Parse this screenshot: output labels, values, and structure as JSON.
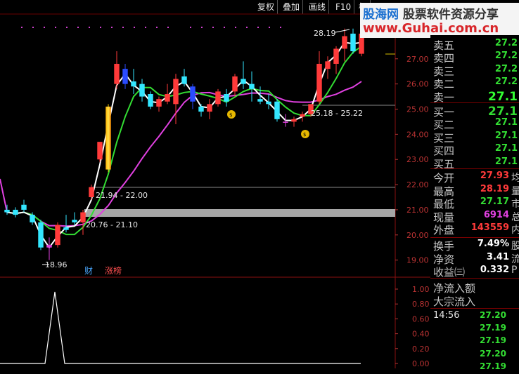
{
  "toolbar": {
    "items": [
      "复权",
      "叠加",
      "画线",
      "F10",
      "标"
    ]
  },
  "watermark": {
    "brand_a": "股海网",
    "brand_b": "股票软件资源分享",
    "url": "www.Guhai.com.cn"
  },
  "chart": {
    "price_axis": [
      "27.00",
      "26.00",
      "25.00",
      "24.00",
      "23.00",
      "22.00",
      "21.00",
      "20.00",
      "19.00"
    ],
    "indicator_axis": [
      "1.00",
      "0.80",
      "0.60",
      "0.40",
      "0.20",
      "0.00"
    ],
    "labels": {
      "high": "28.19",
      "low": "18.96",
      "range1": "21.94 - 22.00",
      "range2": "20.76 - 21.10",
      "range3": "25.18 - 25.22"
    },
    "tags": {
      "cai": "财",
      "zhangbang": "涨榜"
    },
    "colors": {
      "up": "#ff3a3a",
      "down": "#33e6ff",
      "ma_white": "#ffffff",
      "ma_green": "#33dd33",
      "ma_magenta": "#e040e0",
      "axis_red": "#b33333"
    },
    "chart_data": {
      "type": "candlestick",
      "series": [
        {
          "o": 21.0,
          "h": 21.2,
          "l": 20.8,
          "c": 20.9
        },
        {
          "o": 21.0,
          "h": 21.1,
          "l": 20.7,
          "c": 20.8
        },
        {
          "o": 21.2,
          "h": 21.4,
          "l": 20.9,
          "c": 21.0
        },
        {
          "o": 20.8,
          "h": 20.9,
          "l": 20.4,
          "c": 20.5
        },
        {
          "o": 20.5,
          "h": 20.6,
          "l": 19.4,
          "c": 19.5
        },
        {
          "o": 19.6,
          "h": 19.9,
          "l": 19.0,
          "c": 19.5
        },
        {
          "o": 19.6,
          "h": 20.5,
          "l": 19.5,
          "c": 20.4
        },
        {
          "o": 20.3,
          "h": 20.8,
          "l": 20.1,
          "c": 20.2
        },
        {
          "o": 20.6,
          "h": 20.9,
          "l": 20.4,
          "c": 20.5
        },
        {
          "o": 20.5,
          "h": 21.0,
          "l": 20.0,
          "c": 20.9
        },
        {
          "o": 21.5,
          "h": 22.0,
          "l": 21.4,
          "c": 21.9
        },
        {
          "o": 23.0,
          "h": 23.5,
          "l": 22.9,
          "c": 23.7
        },
        {
          "o": 22.6,
          "h": 25.2,
          "l": 22.5,
          "c": 25.1
        },
        {
          "o": 26.0,
          "h": 27.3,
          "l": 25.8,
          "c": 26.8
        },
        {
          "o": 26.6,
          "h": 26.8,
          "l": 25.8,
          "c": 26.0
        },
        {
          "o": 26.1,
          "h": 26.6,
          "l": 25.6,
          "c": 25.9
        },
        {
          "o": 26.0,
          "h": 26.2,
          "l": 25.3,
          "c": 25.5
        },
        {
          "o": 25.6,
          "h": 25.7,
          "l": 25.0,
          "c": 25.1
        },
        {
          "o": 25.1,
          "h": 25.5,
          "l": 24.9,
          "c": 25.4
        },
        {
          "o": 25.3,
          "h": 26.0,
          "l": 25.2,
          "c": 25.6
        },
        {
          "o": 25.2,
          "h": 26.4,
          "l": 24.4,
          "c": 26.2
        },
        {
          "o": 26.3,
          "h": 26.6,
          "l": 25.9,
          "c": 26.0
        },
        {
          "o": 25.9,
          "h": 26.0,
          "l": 25.0,
          "c": 25.3
        },
        {
          "o": 25.1,
          "h": 25.2,
          "l": 24.7,
          "c": 24.9
        },
        {
          "o": 24.9,
          "h": 25.4,
          "l": 24.6,
          "c": 25.2
        },
        {
          "o": 25.2,
          "h": 25.8,
          "l": 25.1,
          "c": 25.7
        },
        {
          "o": 25.6,
          "h": 25.8,
          "l": 25.1,
          "c": 25.3
        },
        {
          "o": 25.7,
          "h": 26.4,
          "l": 25.5,
          "c": 26.3
        },
        {
          "o": 26.2,
          "h": 26.9,
          "l": 25.8,
          "c": 26.0
        },
        {
          "o": 26.0,
          "h": 26.5,
          "l": 25.3,
          "c": 25.8
        },
        {
          "o": 25.4,
          "h": 25.9,
          "l": 25.2,
          "c": 25.3
        },
        {
          "o": 25.3,
          "h": 25.6,
          "l": 25.0,
          "c": 25.2
        },
        {
          "o": 25.3,
          "h": 25.4,
          "l": 24.5,
          "c": 24.6
        },
        {
          "o": 24.5,
          "h": 24.8,
          "l": 24.3,
          "c": 24.5
        },
        {
          "o": 24.5,
          "h": 24.7,
          "l": 24.3,
          "c": 24.6
        },
        {
          "o": 24.7,
          "h": 24.9,
          "l": 24.5,
          "c": 24.8
        },
        {
          "o": 24.8,
          "h": 25.2,
          "l": 24.7,
          "c": 25.2
        },
        {
          "o": 25.3,
          "h": 27.3,
          "l": 25.2,
          "c": 26.8
        },
        {
          "o": 26.6,
          "h": 27.1,
          "l": 26.2,
          "c": 26.9
        },
        {
          "o": 26.8,
          "h": 27.5,
          "l": 26.4,
          "c": 27.4
        },
        {
          "o": 27.4,
          "h": 28.2,
          "l": 26.9,
          "c": 27.9
        },
        {
          "o": 28.0,
          "h": 28.2,
          "l": 27.2,
          "c": 27.3
        },
        {
          "o": 27.2,
          "h": 28.0,
          "l": 27.1,
          "c": 28.0
        }
      ],
      "ylim": [
        18.6,
        28.5
      ]
    }
  },
  "quote": {
    "sell": [
      {
        "label": "卖五",
        "price": "27.2"
      },
      {
        "label": "卖四",
        "price": "27.2"
      },
      {
        "label": "卖三",
        "price": "27.2"
      },
      {
        "label": "卖二",
        "price": "27.2"
      },
      {
        "label": "卖一",
        "price": "27.1"
      }
    ],
    "buy": [
      {
        "label": "买一",
        "price": "27.1"
      },
      {
        "label": "买二",
        "price": "27.1"
      },
      {
        "label": "买三",
        "price": "27.1"
      },
      {
        "label": "买四",
        "price": "27.1"
      },
      {
        "label": "买五",
        "price": "27.1"
      }
    ],
    "stats": [
      {
        "label": "今开",
        "value": "27.93",
        "color": "#ff3a3a",
        "cut": "均"
      },
      {
        "label": "最高",
        "value": "28.19",
        "color": "#ff3a3a",
        "cut": "量"
      },
      {
        "label": "最低",
        "value": "27.17",
        "color": "#33dd33",
        "cut": "市"
      },
      {
        "label": "现量",
        "value": "6914",
        "color": "#e040e0",
        "cut": "总"
      },
      {
        "label": "外盘",
        "value": "143559",
        "color": "#ff3a3a",
        "cut": "内"
      }
    ],
    "stats2": [
      {
        "label": "换手",
        "value": "7.49%",
        "color": "#ffffff",
        "cut": "股"
      },
      {
        "label": "净资",
        "value": "3.41",
        "color": "#ffffff",
        "cut": "流"
      },
      {
        "label": "收益㈢",
        "value": "0.332",
        "color": "#ffffff",
        "cut": "P"
      }
    ],
    "flow": [
      "净流入额",
      "大宗流入"
    ],
    "ticks": {
      "time": "14:56",
      "prices": [
        "27.20",
        "27.19",
        "27.19",
        "27.20",
        "27.19"
      ]
    }
  }
}
